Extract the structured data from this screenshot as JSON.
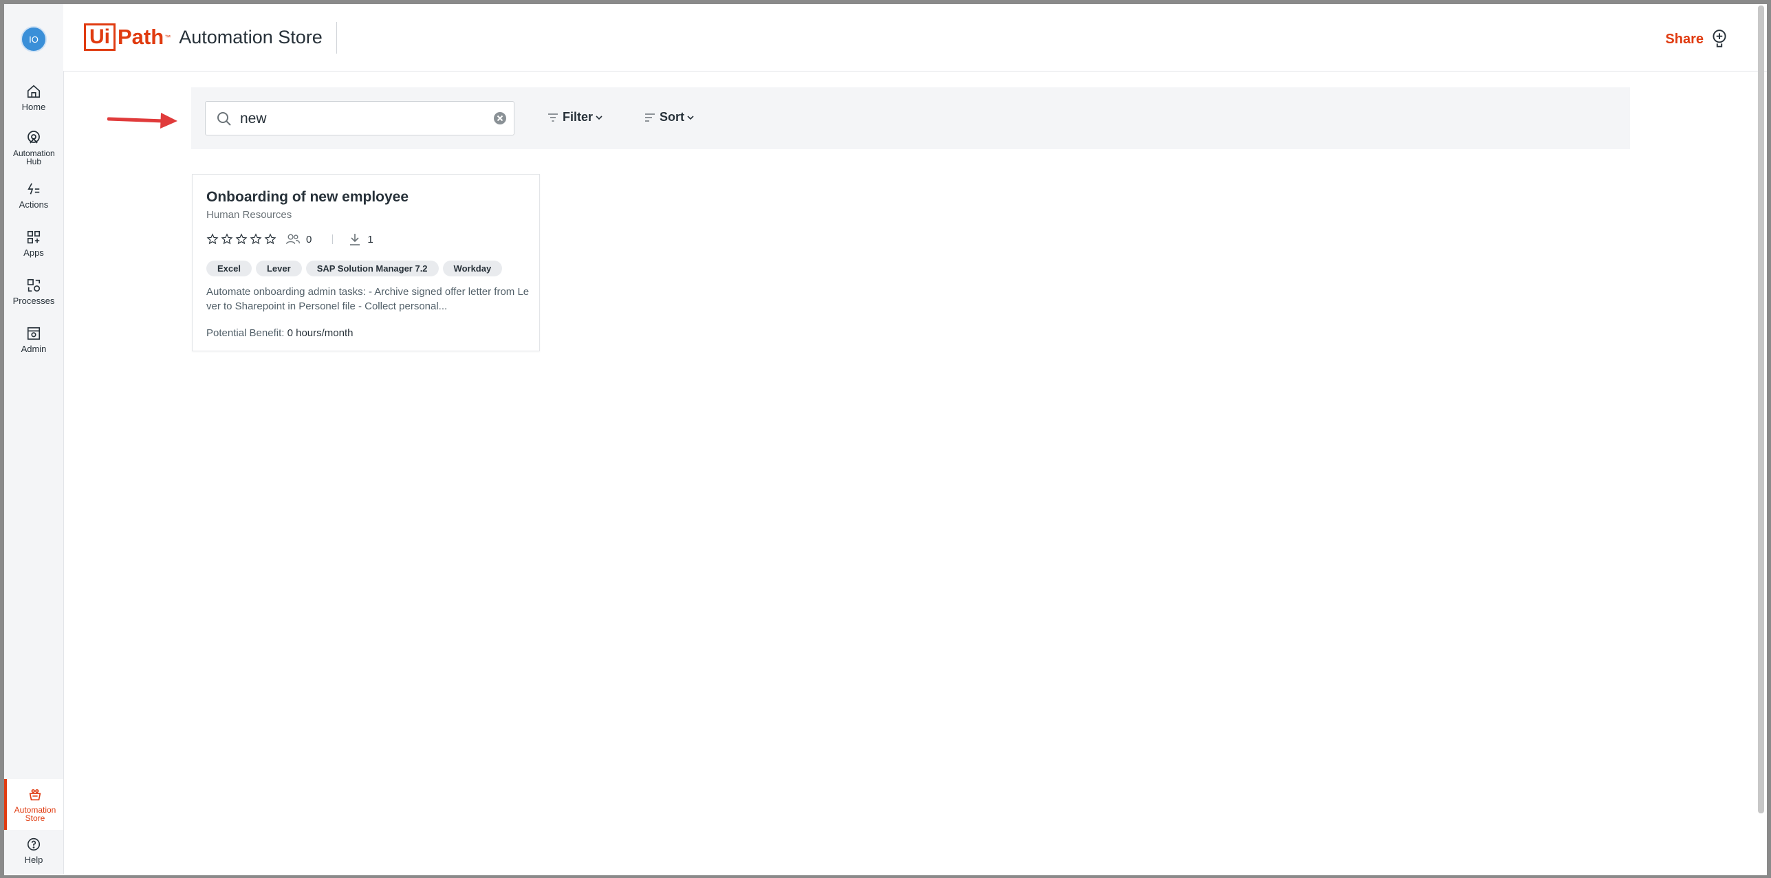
{
  "user": {
    "initials": "IO"
  },
  "nav": {
    "home": "Home",
    "automation_hub": "Automation Hub",
    "actions": "Actions",
    "apps": "Apps",
    "processes": "Processes",
    "admin": "Admin",
    "automation_store": "Automation Store",
    "help": "Help"
  },
  "header": {
    "logo_box": "Ui",
    "logo_path": "Path",
    "logo_tm": "™",
    "title": "Automation Store",
    "share_label": "Share"
  },
  "toolbar": {
    "search_value": "new",
    "filter_label": "Filter",
    "sort_label": "Sort"
  },
  "card": {
    "title": "Onboarding of new employee",
    "category": "Human Resources",
    "rating": 0,
    "users_count": "0",
    "downloads_count": "1",
    "tags": [
      "Excel",
      "Lever",
      "SAP Solution Manager 7.2",
      "Workday"
    ],
    "description": "Automate onboarding admin tasks: - Archive signed offer letter from Lever to Sharepoint in Personel file - Collect personal...",
    "benefit_label": "Potential Benefit:",
    "benefit_value": "0 hours/month"
  },
  "colors": {
    "accent": "#e03b10",
    "avatar": "#3a8fd8",
    "annotation_arrow": "#e03b3b"
  }
}
